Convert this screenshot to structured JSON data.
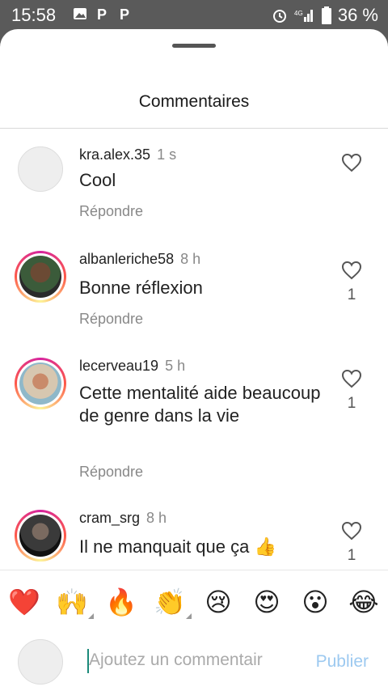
{
  "status_bar": {
    "time": "15:58",
    "battery": "36 %",
    "left_icons": [
      "image-icon",
      "p-icon",
      "p-icon"
    ],
    "right_icons": [
      "alarm-icon",
      "signal-icon",
      "battery-icon"
    ]
  },
  "sheet": {
    "title": "Commentaires"
  },
  "comments": [
    {
      "username": "kra.alex.35",
      "time": "1 s",
      "text": "Cool",
      "reply_label": "Répondre",
      "likes": ""
    },
    {
      "username": "albanleriche58",
      "time": "8 h",
      "text": "Bonne réflexion",
      "reply_label": "Répondre",
      "likes": "1"
    },
    {
      "username": "lecerveau19",
      "time": "5 h",
      "text": "Cette mentalité aide beaucoup de genre dans la vie",
      "reply_label": "Répondre",
      "likes": "1"
    },
    {
      "username": "cram_srg",
      "time": "8 h",
      "text": "Il ne manquait que ça 👍",
      "reply_label": "",
      "likes": "1"
    }
  ],
  "emoji_bar": [
    "❤️",
    "🙌",
    "🔥",
    "👏",
    "😢",
    "😍",
    "😮",
    "😂"
  ],
  "composer": {
    "placeholder": "Ajoutez un commentair",
    "publish_label": "Publier"
  },
  "colors": {
    "accent": "#9cc9f0",
    "story_ring": "#d6249f",
    "heart_outline": "#555555"
  }
}
